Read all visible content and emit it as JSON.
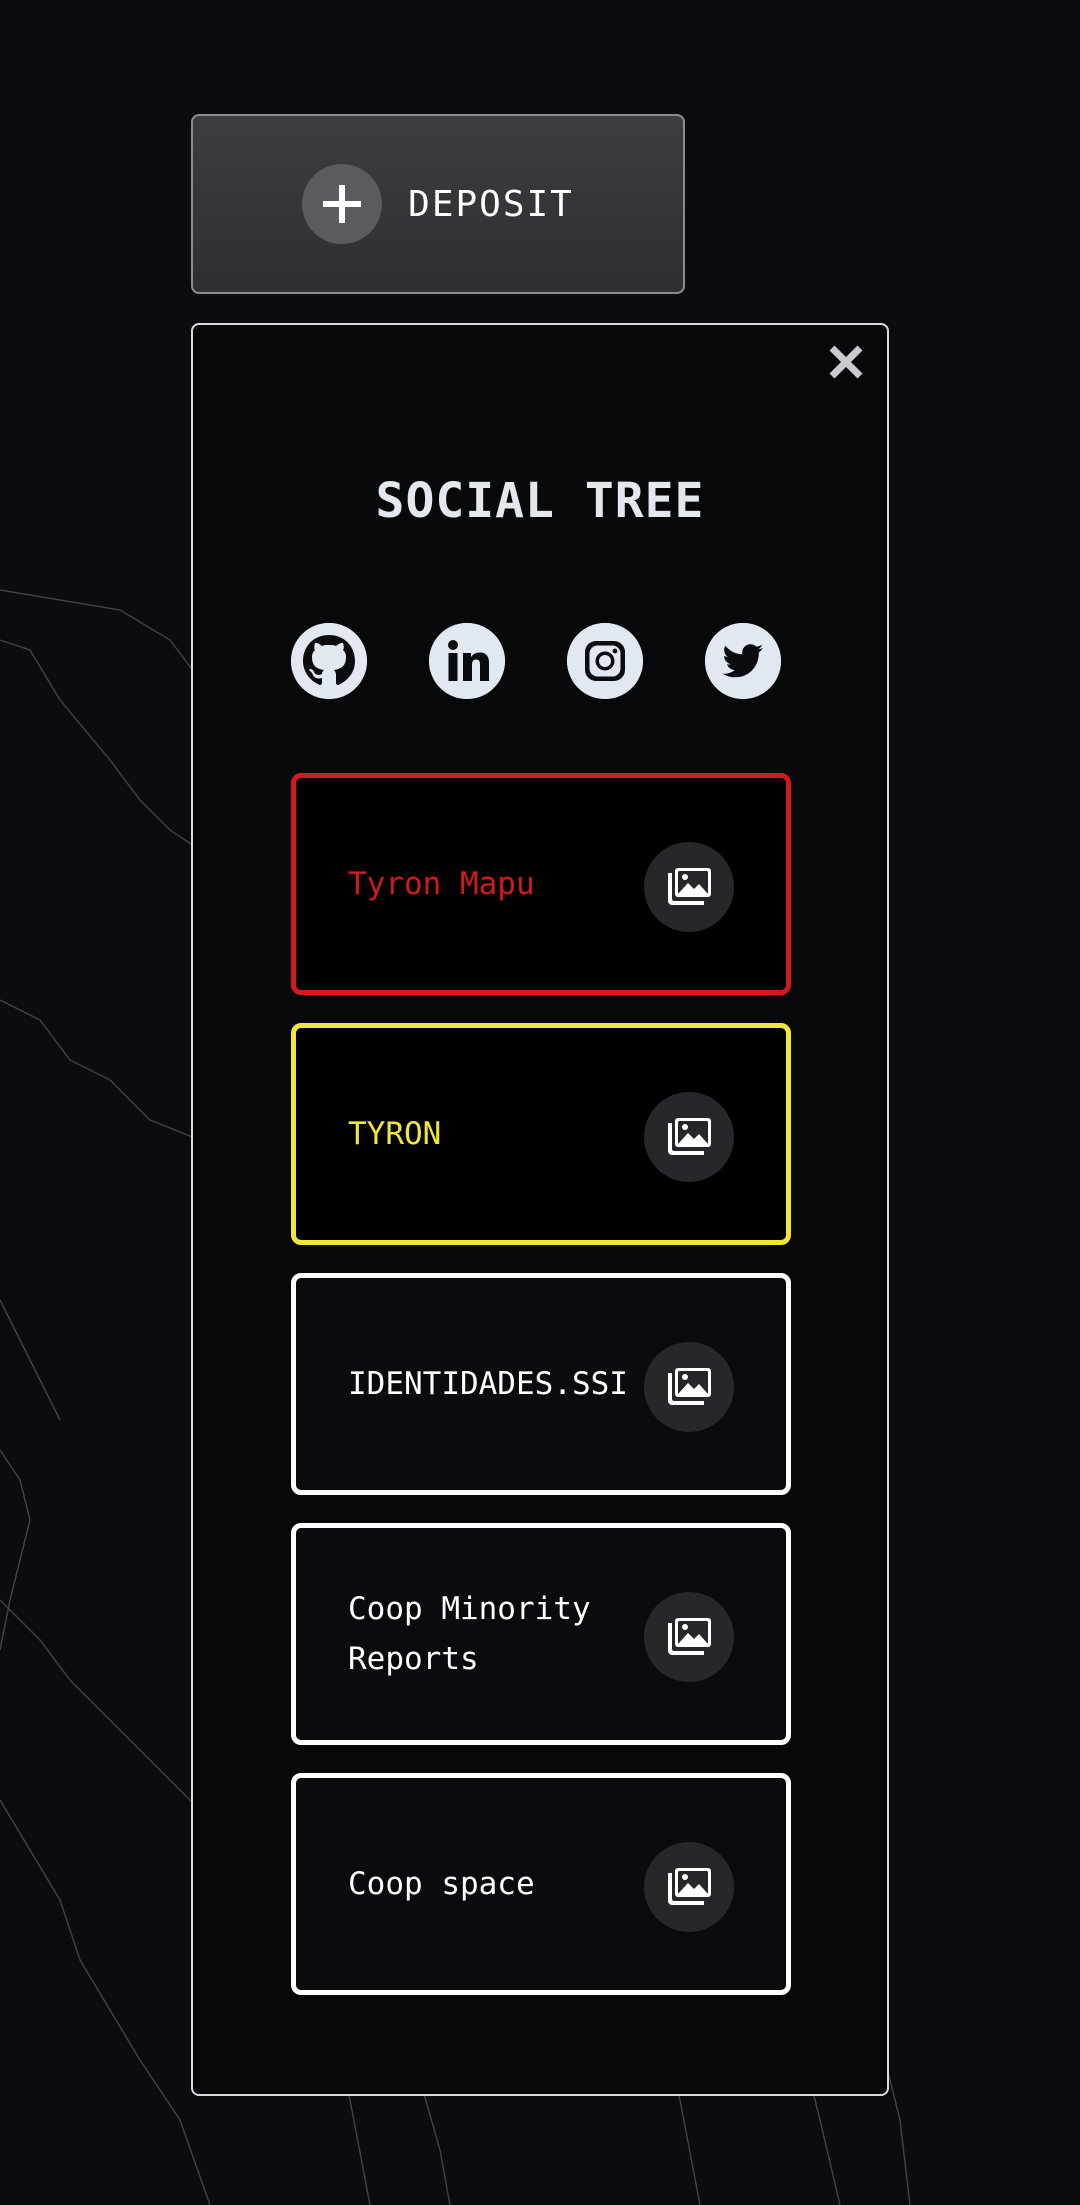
{
  "deposit": {
    "label": "DEPOSIT",
    "icon": "plus-icon"
  },
  "panel": {
    "close_icon": "close-icon",
    "title": "SOCIAL TREE",
    "social": [
      {
        "name": "github",
        "icon": "github-icon"
      },
      {
        "name": "linkedin",
        "icon": "linkedin-icon"
      },
      {
        "name": "instagram",
        "icon": "instagram-icon"
      },
      {
        "name": "twitter",
        "icon": "twitter-icon"
      }
    ],
    "links": [
      {
        "label": "Tyron Mapu",
        "color": "#d11a1a",
        "border": "#d11a1a",
        "bg": "#000000",
        "icon": "images-icon"
      },
      {
        "label": "TYRON",
        "color": "#f2e63a",
        "border": "#f2e63a",
        "bg": "#000000",
        "icon": "images-icon"
      },
      {
        "label": "IDENTIDADES.SSI",
        "color": "#ffffff",
        "border": "#ffffff",
        "bg": "#0a0b0e",
        "icon": "images-icon"
      },
      {
        "label": "Coop Minority Reports",
        "color": "#ffffff",
        "border": "#ffffff",
        "bg": "#0a0b0e",
        "icon": "images-icon"
      },
      {
        "label": "Coop space",
        "color": "#ffffff",
        "border": "#ffffff",
        "bg": "#0a0b0e",
        "icon": "images-icon"
      }
    ]
  },
  "colors": {
    "background": "#0b0c0f",
    "panel_border": "#d9dbe0",
    "social_icon_bg": "#e2e8f0"
  }
}
